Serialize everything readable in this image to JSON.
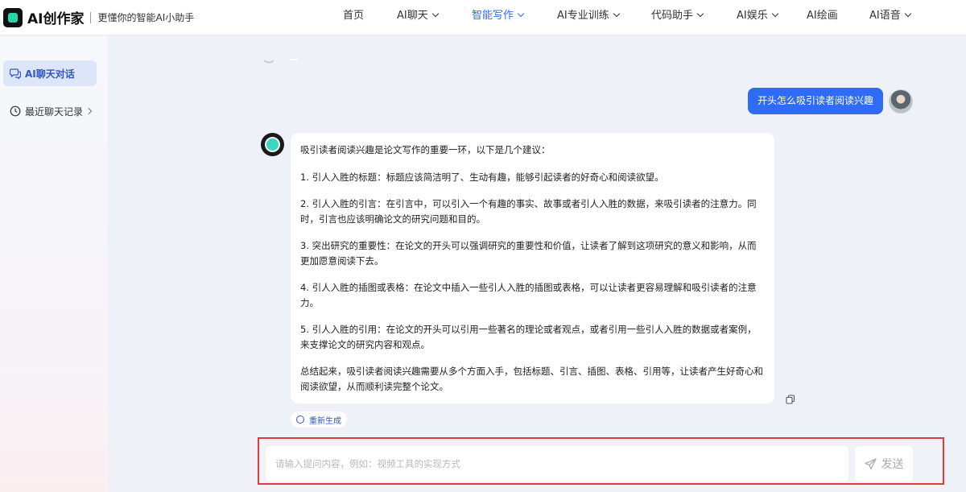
{
  "app": {
    "title": "AI创作家",
    "slogan": "更懂你的智能AI小助手"
  },
  "nav": {
    "items": [
      {
        "label": "首页",
        "dropdown": false
      },
      {
        "label": "AI聊天",
        "dropdown": true
      },
      {
        "label": "智能写作",
        "dropdown": true,
        "active": true
      },
      {
        "label": "AI专业训练",
        "dropdown": true
      },
      {
        "label": "代码助手",
        "dropdown": true
      },
      {
        "label": "AI娱乐",
        "dropdown": true
      },
      {
        "label": "AI绘画",
        "dropdown": false
      },
      {
        "label": "AI语音",
        "dropdown": true
      }
    ]
  },
  "sidebar": {
    "items": [
      {
        "label": "AI聊天对话",
        "icon": "chat-bubbles-icon",
        "active": true
      },
      {
        "label": "最近聊天记录",
        "icon": "clock-icon",
        "active": false
      }
    ]
  },
  "chat": {
    "user_message": "开头怎么吸引读者阅读兴趣",
    "bot_paragraphs": [
      "吸引读者阅读兴趣是论文写作的重要一环，以下是几个建议：",
      "1. 引人入胜的标题：标题应该简洁明了、生动有趣，能够引起读者的好奇心和阅读欲望。",
      "2. 引人入胜的引言：在引言中，可以引入一个有趣的事实、故事或者引人入胜的数据，来吸引读者的注意力。同时，引言也应该明确论文的研究问题和目的。",
      "3. 突出研究的重要性：在论文的开头可以强调研究的重要性和价值，让读者了解到这项研究的意义和影响，从而更加愿意阅读下去。",
      "4. 引人入胜的插图或表格：在论文中插入一些引人入胜的插图或表格，可以让读者更容易理解和吸引读者的注意力。",
      "5. 引人入胜的引用：在论文的开头可以引用一些著名的理论或者观点，或者引用一些引人入胜的数据或者案例，来支撑论文的研究内容和观点。",
      "总结起来，吸引读者阅读兴趣需要从多个方面入手，包括标题、引言、插图、表格、引用等，让读者产生好奇心和阅读欲望，从而顺利读完整个论文。"
    ],
    "regenerate_label": "重新生成"
  },
  "composer": {
    "placeholder": "请输入提问内容，例如：视频工具的实现方式",
    "value": "",
    "send_label": "发送"
  },
  "colors": {
    "accent": "#2f6cf6",
    "highlight_border": "#e23b3b"
  }
}
